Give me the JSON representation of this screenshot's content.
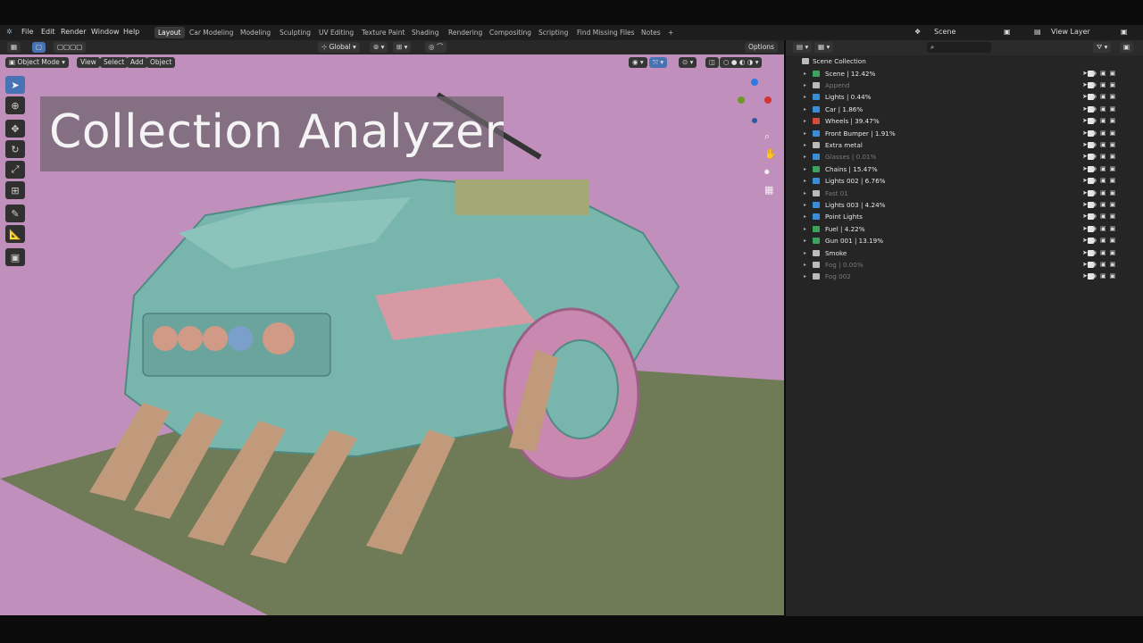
{
  "menu": {
    "items": [
      "File",
      "Edit",
      "Render",
      "Window",
      "Help"
    ],
    "workspaces": [
      "Layout",
      "Car Modeling",
      "Modeling",
      "Sculpting",
      "UV Editing",
      "Texture Paint",
      "Shading",
      "Rendering",
      "Compositing",
      "Scripting",
      "Find Missing Files",
      "Notes"
    ],
    "add_tab": "+",
    "scene": "Scene",
    "view_layer": "View Layer"
  },
  "toolbar": {
    "orientation": "Global",
    "options": "Options"
  },
  "viewport_header": {
    "mode": "Object Mode",
    "menus": [
      "View",
      "Select",
      "Add",
      "Object"
    ]
  },
  "title": "Collection Analyzer",
  "outliner": {
    "root": "Scene Collection",
    "rows": [
      {
        "name": "Scene",
        "pct": "12.42%",
        "color": "#3aa35c",
        "dim": false
      },
      {
        "name": "Append",
        "pct": "",
        "color": "",
        "dim": true
      },
      {
        "name": "Lights",
        "pct": "0.44%",
        "color": "#3a8ed6",
        "dim": false
      },
      {
        "name": "Car",
        "pct": "1.86%",
        "color": "#3a8ed6",
        "dim": false
      },
      {
        "name": "Wheels",
        "pct": "39.47%",
        "color": "#d64b3a",
        "dim": false
      },
      {
        "name": "Front Bumper",
        "pct": "1.91%",
        "color": "#3a8ed6",
        "dim": false
      },
      {
        "name": "Extra metal",
        "pct": "",
        "color": "",
        "dim": false
      },
      {
        "name": "Glasses",
        "pct": "0.01%",
        "color": "#3a8ed6",
        "dim": true
      },
      {
        "name": "Chains",
        "pct": "15.47%",
        "color": "#3aa35c",
        "dim": false
      },
      {
        "name": "Lights 002",
        "pct": "6.76%",
        "color": "#3a8ed6",
        "dim": false
      },
      {
        "name": "Fast 01",
        "pct": "",
        "color": "",
        "dim": true
      },
      {
        "name": "Lights 003",
        "pct": "4.24%",
        "color": "#3a8ed6",
        "dim": false
      },
      {
        "name": "Point Lights",
        "pct": "",
        "color": "#3a8ed6",
        "dim": false
      },
      {
        "name": "Fuel",
        "pct": "4.22%",
        "color": "#3aa35c",
        "dim": false
      },
      {
        "name": "Gun 001",
        "pct": "13.19%",
        "color": "#3aa35c",
        "dim": false
      },
      {
        "name": "Smoke",
        "pct": "",
        "color": "",
        "dim": false
      },
      {
        "name": "Fog",
        "pct": "0.00%",
        "color": "",
        "dim": true
      },
      {
        "name": "Fog 002",
        "pct": "",
        "color": "",
        "dim": true
      }
    ]
  },
  "colors": {
    "viewport_bg": "#c08fbc",
    "ground": "#6f7a56",
    "car_body": "#78b5ad",
    "accent": "#4772b3"
  }
}
